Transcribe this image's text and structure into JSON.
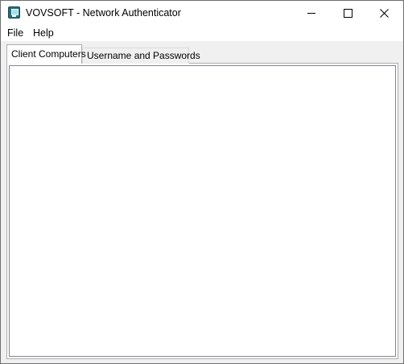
{
  "window": {
    "title": "VOVSOFT - Network Authenticator",
    "app_icon": "network-computer-icon"
  },
  "caption_buttons": {
    "minimize_icon": "minimize-icon",
    "maximize_icon": "maximize-icon",
    "close_icon": "close-icon"
  },
  "menu": {
    "items": [
      {
        "label": "File"
      },
      {
        "label": "Help"
      }
    ]
  },
  "tabs": [
    {
      "label": "Client Computers",
      "active": true
    },
    {
      "label": "Username and Passwords",
      "active": false
    }
  ],
  "client_computers": {
    "items": []
  }
}
